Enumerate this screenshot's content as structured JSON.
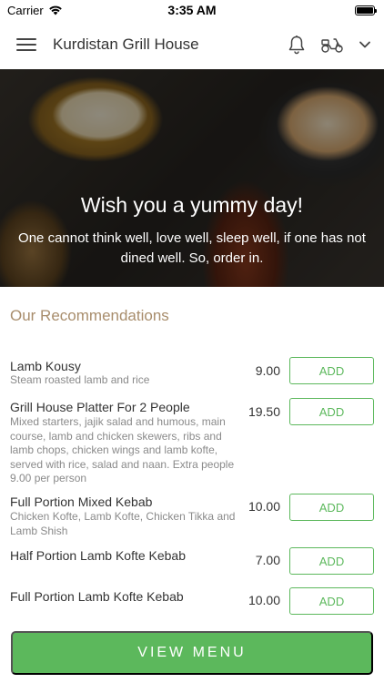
{
  "status_bar": {
    "carrier": "Carrier",
    "time": "3:35 AM"
  },
  "header": {
    "title": "Kurdistan Grill House"
  },
  "hero": {
    "title": "Wish you a yummy day!",
    "subtitle": "One cannot think well, love well, sleep well, if one has not dined well. So, order in."
  },
  "recommendations": {
    "title": "Our Recommendations",
    "add_label": "ADD",
    "items": [
      {
        "name": "Lamb Kousy",
        "description": "Steam roasted lamb and rice",
        "price": "9.00"
      },
      {
        "name": "Grill House Platter For 2 People",
        "description": "Mixed starters, jajik salad and humous, main course, lamb and chicken skewers, ribs and lamb chops, chicken wings and lamb kofte, served with rice, salad and naan. Extra people 9.00 per person",
        "price": "19.50"
      },
      {
        "name": "Full Portion Mixed Kebab",
        "description": "Chicken Kofte, Lamb Kofte, Chicken Tikka and Lamb Shish",
        "price": "10.00"
      },
      {
        "name": "Half Portion Lamb Kofte Kebab",
        "description": "",
        "price": "7.00"
      },
      {
        "name": "Full Portion Lamb Kofte Kebab",
        "description": "",
        "price": "10.00"
      }
    ]
  },
  "footer": {
    "view_menu_label": "VIEW MENU"
  },
  "colors": {
    "accent": "#5cb85c",
    "section_title": "#a88d6c"
  }
}
